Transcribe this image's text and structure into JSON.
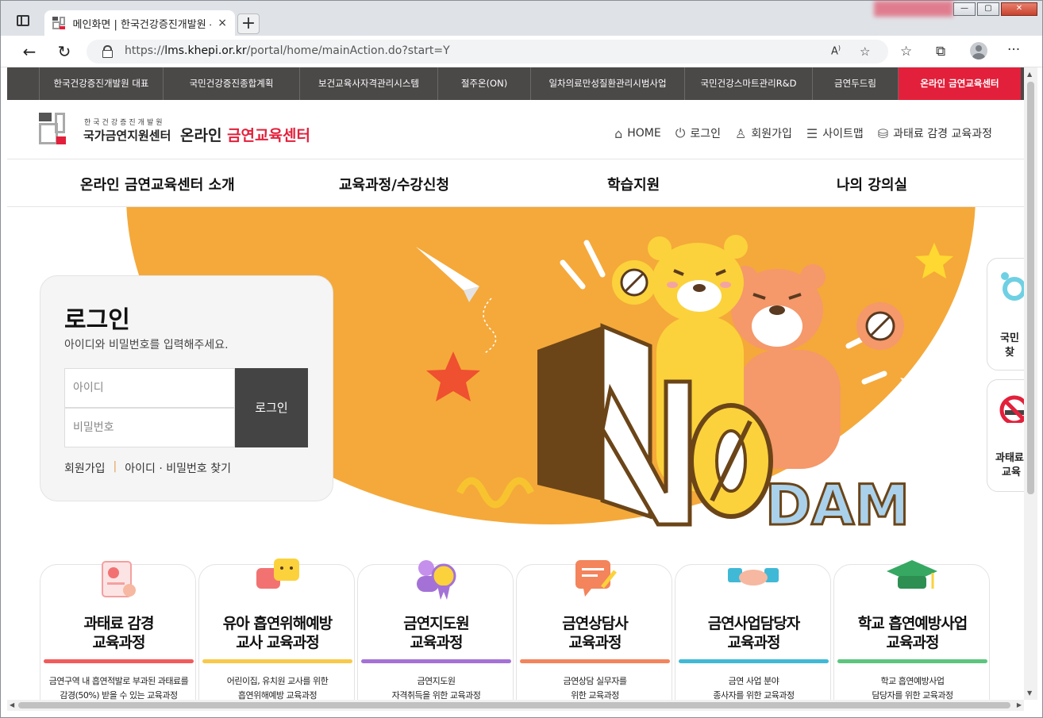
{
  "browser": {
    "tab_title": "메인화면 | 한국건강증진개발원 - 온",
    "tab_close": "×",
    "new_tab": "+",
    "url_prefix": "https://",
    "url_host": "lms.khepi.or.kr",
    "url_path": "/portal/home/mainAction.do?start=Y",
    "win_min": "—",
    "win_max": "▢",
    "win_close": "✕",
    "read_aloud": "A",
    "more": "···"
  },
  "family_sites": [
    {
      "label": "한국건강증진개발원 대표",
      "width": 156
    },
    {
      "label": "국민건강증진종합계획",
      "width": 172
    },
    {
      "label": "보건교육사자격관리시스템",
      "width": 174
    },
    {
      "label": "절주온(ON)",
      "width": 117
    },
    {
      "label": "일차의료만성질환관리시범사업",
      "width": 194
    },
    {
      "label": "국민건강스마트관리R&D",
      "width": 161
    },
    {
      "label": "금연두드림",
      "width": 108
    },
    {
      "label": "온라인 금연교육센터",
      "width": 155,
      "active": true
    }
  ],
  "header": {
    "logo_sub": "한국건강증진개발원",
    "logo_main": "국가금연지원센터",
    "site_prefix": "온라인 ",
    "site_highlight": "금연교육센터",
    "util": [
      {
        "icon": "home-icon",
        "glyph": "⌂",
        "label": "HOME"
      },
      {
        "icon": "power-icon",
        "glyph": "⏻",
        "label": "로그인"
      },
      {
        "icon": "user-icon",
        "glyph": "♙",
        "label": "회원가입"
      },
      {
        "icon": "menu-icon",
        "glyph": "☰",
        "label": "사이트맵"
      },
      {
        "icon": "coins-icon",
        "glyph": "⛁",
        "label": "과태료 감경 교육과정"
      }
    ]
  },
  "gnb": [
    "온라인 금연교육센터 소개",
    "교육과정/수강신청",
    "학습지원",
    "나의 강의실"
  ],
  "login": {
    "title": "로그인",
    "desc": "아이디와 비밀번호를 입력해주세요.",
    "id_placeholder": "아이디",
    "pw_placeholder": "비밀번호",
    "submit": "로그인",
    "join": "회원가입",
    "sep": "|",
    "find": "아이디 · 비밀번호 찾기"
  },
  "hero": {
    "logo_text_n": "N",
    "logo_text_o": "O",
    "logo_text_dam": "DAM"
  },
  "quick": [
    {
      "line1": "국민",
      "line2": "찾"
    },
    {
      "line1": "과태료",
      "line2": "교육"
    }
  ],
  "courses": [
    {
      "title1": "과태료 감경",
      "title2": "교육과정",
      "sub1": "금연구역 내 흡연적발로 부과된 과태료를",
      "sub2": "감경(50%) 받을 수 있는 교육과정",
      "color": "#f25b5b"
    },
    {
      "title1": "유아 흡연위해예방",
      "title2": "교사 교육과정",
      "sub1": "어린이집, 유치원 교사를 위한",
      "sub2": "흡연위해예방 교육과정",
      "color": "#f8c94a"
    },
    {
      "title1": "금연지도원",
      "title2": "교육과정",
      "sub1": "금연지도원",
      "sub2": "자격취득을 위한 교육과정",
      "color": "#a472d6"
    },
    {
      "title1": "금연상담사",
      "title2": "교육과정",
      "sub1": "금연상담 실무자를",
      "sub2": "위한 교육과정",
      "color": "#f3845b"
    },
    {
      "title1": "금연사업담당자",
      "title2": "교육과정",
      "sub1": "금연 사업 분야",
      "sub2": "종사자를 위한 교육과정",
      "color": "#40b9d6"
    },
    {
      "title1": "학교 흡연예방사업",
      "title2": "교육과정",
      "sub1": "학교 흡연예방사업",
      "sub2": "담당자를 위한 교육과정",
      "color": "#5cc57e"
    }
  ]
}
